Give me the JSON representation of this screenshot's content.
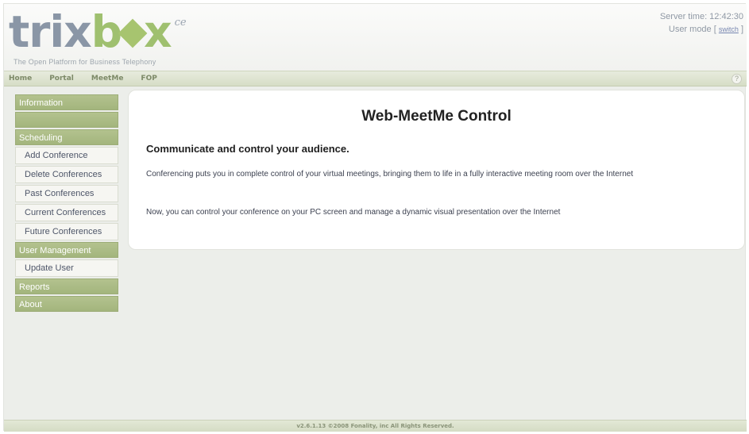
{
  "header": {
    "logo": {
      "part1": "trix",
      "part2": "b",
      "part3": "x",
      "edition": "ce"
    },
    "tagline": "The Open Platform for Business Telephony",
    "server_time": "Server time: 12:42:30",
    "user_mode_label": "User mode [",
    "user_mode_link": "switch",
    "user_mode_close": "]"
  },
  "topnav": {
    "items": [
      "Home",
      "Portal",
      "MeetMe",
      "FOP"
    ],
    "help_icon": "?"
  },
  "sidebar": {
    "information": "Information",
    "scheduling": "Scheduling",
    "scheduling_items": [
      "Add Conference",
      "Delete Conferences",
      "Past Conferences",
      "Current Conferences",
      "Future Conferences"
    ],
    "user_management": "User Management",
    "user_management_items": [
      "Update User"
    ],
    "reports": "Reports",
    "about": "About"
  },
  "main": {
    "title": "Web-MeetMe Control",
    "subtitle": "Communicate and control your audience.",
    "para1": "Conferencing puts you in complete control of your virtual meetings, bringing them to life in a fully interactive meeting room over the Internet",
    "para2": "Now, you can control your conference on your PC screen and manage a dynamic visual presentation over the Internet"
  },
  "footer": {
    "text": "v2.6.1.13 ©2008 Fonality, inc All Rights Reserved."
  },
  "colors": {
    "menu_green": "#a7b882",
    "logo_green": "#9fc06f",
    "logo_gray": "#8a96a6"
  }
}
